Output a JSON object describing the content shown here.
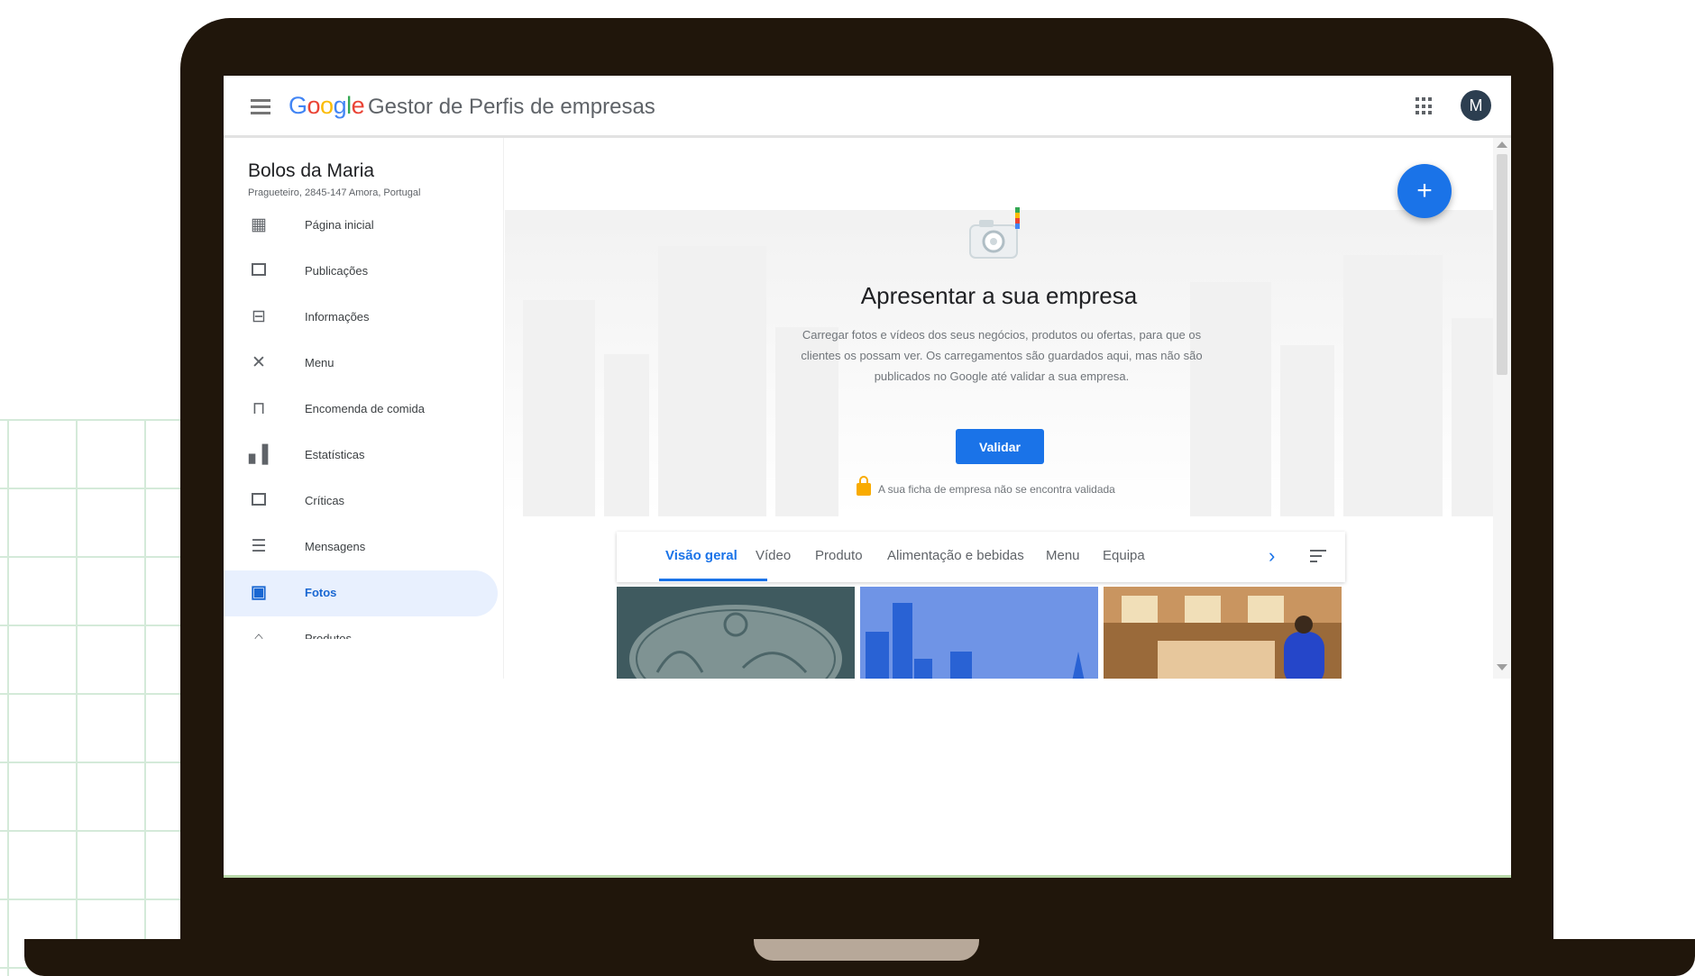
{
  "app": {
    "logo_letters": [
      "G",
      "o",
      "o",
      "g",
      "l",
      "e"
    ],
    "title": "Gestor de Perfis de empresas",
    "avatar_initial": "M"
  },
  "business": {
    "name": "Bolos da Maria",
    "address": "Pragueteiro, 2845-147 Amora, Portugal"
  },
  "sidebar": {
    "items": [
      {
        "label": "Página inicial",
        "icon": "dashboard-icon"
      },
      {
        "label": "Publicações",
        "icon": "posts-icon"
      },
      {
        "label": "Informações",
        "icon": "store-icon"
      },
      {
        "label": "Menu",
        "icon": "fork-knife-icon"
      },
      {
        "label": "Encomenda de comida",
        "icon": "food-order-icon"
      },
      {
        "label": "Estatísticas",
        "icon": "bar-chart-icon"
      },
      {
        "label": "Críticas",
        "icon": "reviews-icon"
      },
      {
        "label": "Mensagens",
        "icon": "messages-icon"
      },
      {
        "label": "Fotos",
        "icon": "photos-icon",
        "active": true
      },
      {
        "label": "Produtos",
        "icon": "products-icon"
      }
    ]
  },
  "hero": {
    "title": "Apresentar a sua empresa",
    "description": "Carregar fotos e vídeos dos seus negócios, produtos ou ofertas, para que os clientes os possam ver. Os carregamentos são guardados aqui, mas não são publicados no Google até validar a sua empresa.",
    "validate_button": "Validar",
    "lock_message": "A sua ficha de empresa não se encontra validada"
  },
  "tabs": [
    {
      "label": "Visão geral",
      "active": true
    },
    {
      "label": "Vídeo"
    },
    {
      "label": "Produto"
    },
    {
      "label": "Alimentação e bebidas"
    },
    {
      "label": "Menu"
    },
    {
      "label": "Equipa"
    }
  ],
  "tab_next_symbol": "›",
  "fab_symbol": "+",
  "colors": {
    "laptop": "#20160b",
    "accent": "#1a73e8",
    "active_nav_bg": "#e8f0fe",
    "grid": "#d4ead9"
  }
}
